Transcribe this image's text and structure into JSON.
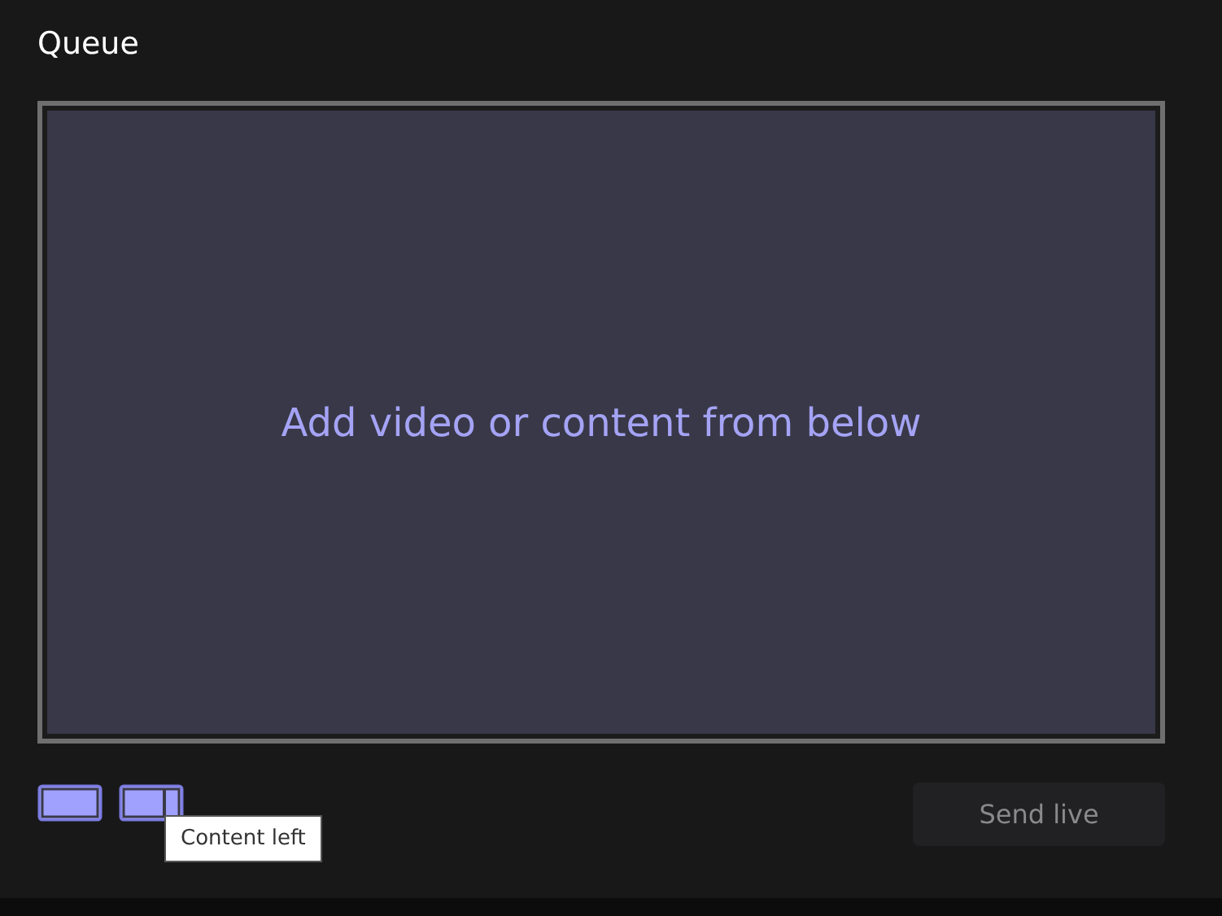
{
  "title": "Queue",
  "preview": {
    "message": "Add video or content from below"
  },
  "layouts": [
    {
      "kind": "full"
    },
    {
      "kind": "content_left",
      "tooltip": "Content left"
    }
  ],
  "send_button": {
    "label": "Send live",
    "disabled": true
  }
}
